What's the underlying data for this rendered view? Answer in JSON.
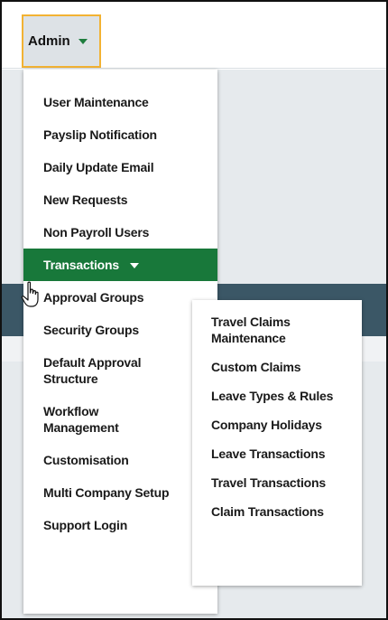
{
  "header": {
    "admin_label": "Admin"
  },
  "admin_menu": {
    "items": [
      {
        "label": "User Maintenance"
      },
      {
        "label": "Payslip Notification"
      },
      {
        "label": "Daily Update Email"
      },
      {
        "label": "New Requests"
      },
      {
        "label": "Non Payroll Users"
      },
      {
        "label": "Transactions",
        "active": true
      },
      {
        "label": "Approval Groups"
      },
      {
        "label": "Security Groups"
      },
      {
        "label": "Default Approval Structure"
      },
      {
        "label": "Workflow Management"
      },
      {
        "label": "Customisation"
      },
      {
        "label": "Multi Company Setup"
      },
      {
        "label": "Support Login"
      }
    ]
  },
  "transactions_submenu": {
    "items": [
      {
        "label": "Travel Claims Maintenance"
      },
      {
        "label": "Custom Claims"
      },
      {
        "label": "Leave Types & Rules"
      },
      {
        "label": "Company Holidays"
      },
      {
        "label": "Leave Transactions"
      },
      {
        "label": "Travel Transactions"
      },
      {
        "label": "Claim Transactions"
      }
    ]
  },
  "colors": {
    "accent_green": "#18783a",
    "focus_border": "#f2b233",
    "banner": "#3b5766"
  },
  "icons": {
    "dropdown": "chevron-down-icon",
    "pointer": "hand-pointer-icon"
  }
}
